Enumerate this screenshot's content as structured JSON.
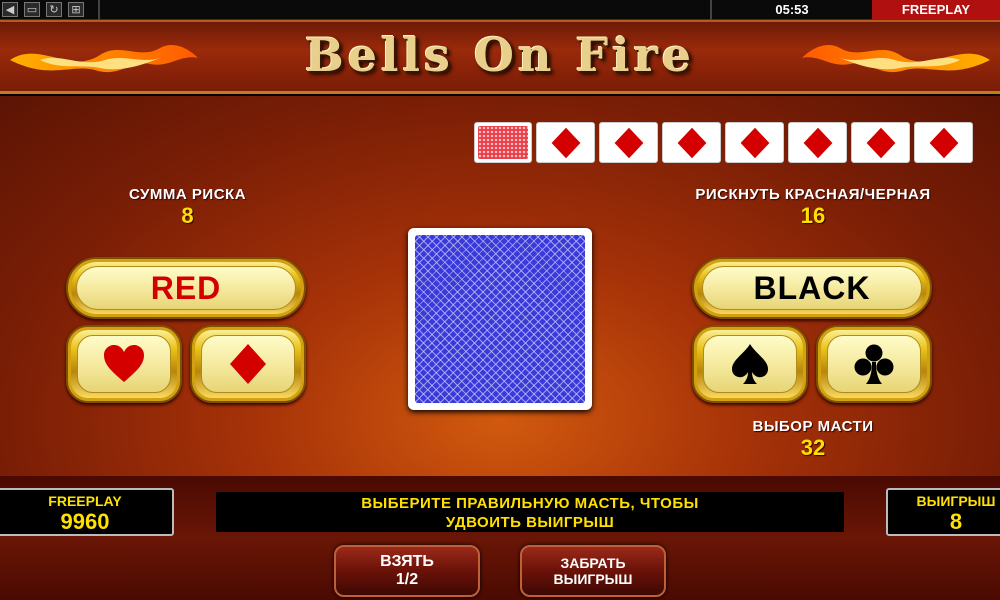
{
  "system_bar": {
    "icons": [
      "sound-icon",
      "window-icon",
      "refresh-icon",
      "expand-icon"
    ],
    "clock": "05:53",
    "mode": "FREEPLAY"
  },
  "game": {
    "title": "Bells On Fire"
  },
  "history": {
    "cards": [
      "back-red",
      "diamond",
      "diamond",
      "diamond",
      "diamond",
      "diamond",
      "diamond",
      "diamond"
    ]
  },
  "risk": {
    "stake_label": "СУММА РИСКА",
    "stake_value": "8",
    "color_label": "РИСКНУТЬ КРАСНАЯ/ЧЕРНАЯ",
    "color_value": "16",
    "suit_label": "ВЫБОР МАСТИ",
    "suit_value": "32"
  },
  "buttons": {
    "red": "RED",
    "black": "BLACK",
    "take_line1": "ВЗЯТЬ",
    "take_line2": "1/2",
    "collect_line1": "ЗАБРАТЬ",
    "collect_line2": "ВЫИГРЫШ"
  },
  "footer": {
    "credit_label": "FREEPLAY",
    "credit_value": "9960",
    "message_line1": "ВЫБЕРИТЕ ПРАВИЛЬНУЮ МАСТЬ, ЧТОБЫ",
    "message_line2": "УДВОИТЬ ВЫИГРЫШ",
    "win_label": "ВЫИГРЫШ",
    "win_value": "8"
  },
  "colors": {
    "red_suit": "#d40000",
    "black_suit": "#000000",
    "gold": "#e8c21a",
    "yellow_text": "#ffe000",
    "mode_bar": "#b01010"
  }
}
